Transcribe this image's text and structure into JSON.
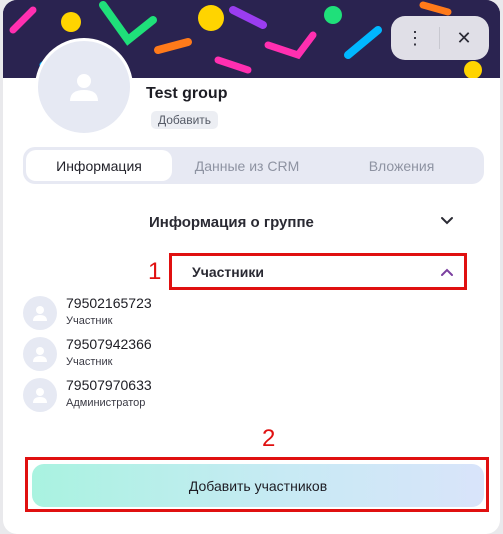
{
  "header": {
    "more_icon": "more-vertical-icon",
    "close_icon": "close-icon"
  },
  "group": {
    "name": "Test group",
    "add_chip_label": "Добавить"
  },
  "tabs": [
    {
      "label": "Информация",
      "active": true
    },
    {
      "label": "Данные из CRM",
      "active": false
    },
    {
      "label": "Вложения",
      "active": false
    }
  ],
  "sections": {
    "group_info": {
      "title": "Информация о группе",
      "expanded": false
    },
    "participants": {
      "title": "Участники",
      "expanded": true
    }
  },
  "members": [
    {
      "phone": "79502165723",
      "role": "Участник"
    },
    {
      "phone": "79507942366",
      "role": "Участник"
    },
    {
      "phone": "79507970633",
      "role": "Администратор"
    }
  ],
  "add_members_button": {
    "label": "Добавить участников"
  },
  "annotations": {
    "first": "1",
    "second": "2",
    "color": "#e01010"
  },
  "colors": {
    "tab_bg": "#e7e9f3",
    "banner_bg": "#2a2350",
    "accent_chevron": "#7b3fa0"
  }
}
